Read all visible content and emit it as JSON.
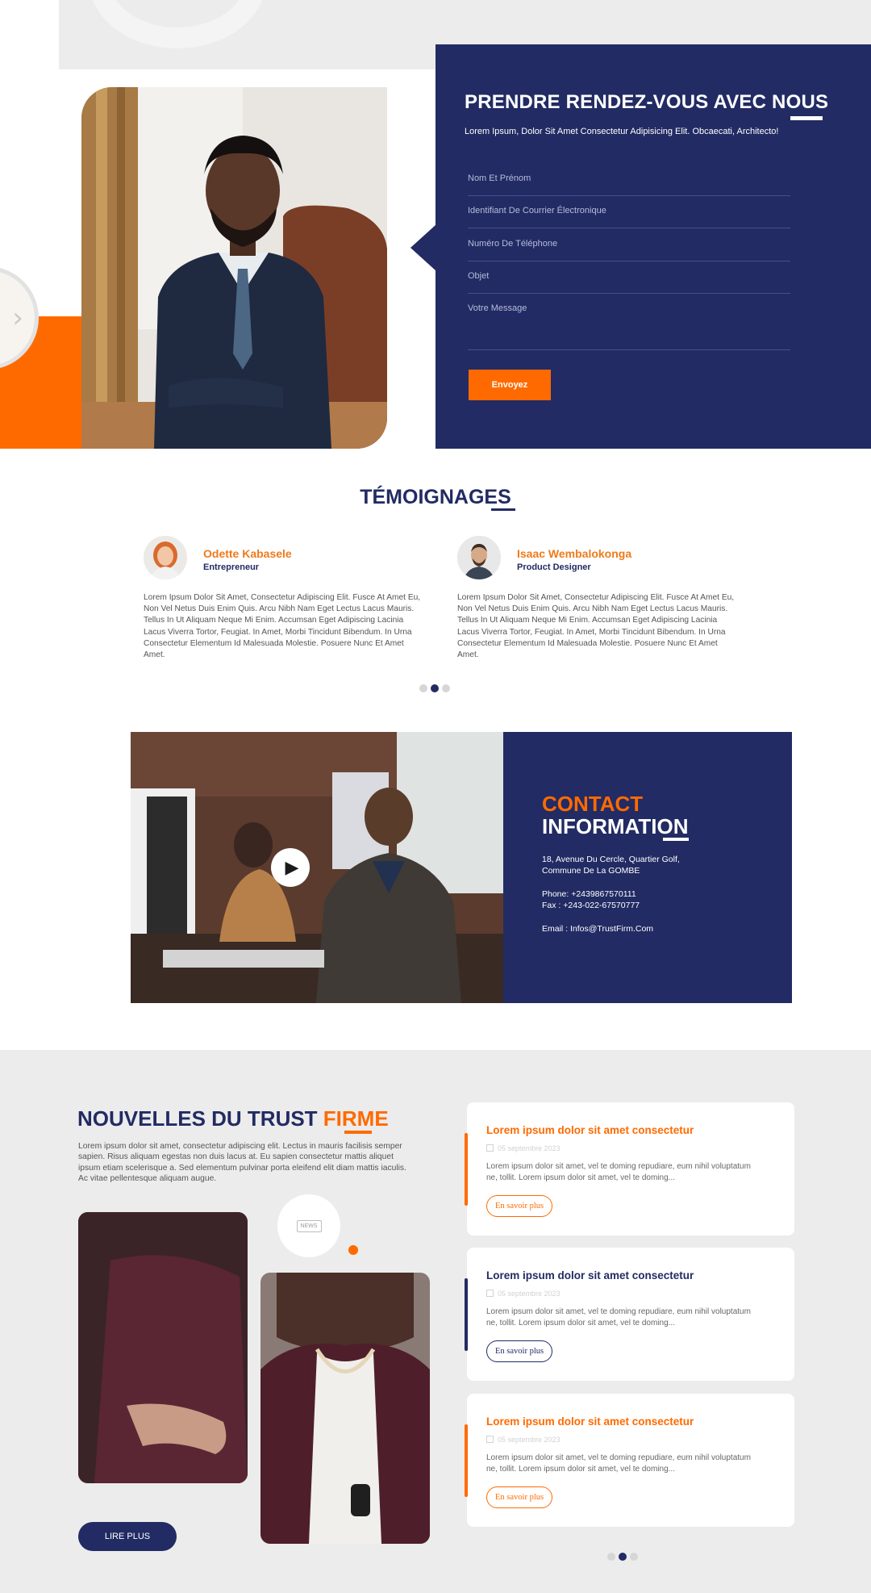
{
  "appointment": {
    "title": "PRENDRE RENDEZ-VOUS AVEC NOUS",
    "subtitle": "Lorem Ipsum, Dolor Sit Amet Consectetur Adipisicing Elit. Obcaecati, Architecto!",
    "fields": {
      "name": "Nom Et Prénom",
      "email": "Identifiant De Courrier Électronique",
      "phone": "Numéro De Téléphone",
      "subject": "Objet",
      "message": "Votre Message"
    },
    "submit_label": "Envoyez"
  },
  "testimonials": {
    "title": "TÉMOIGNAGES",
    "items": [
      {
        "name": "Odette Kabasele",
        "role": "Entrepreneur",
        "text": "Lorem Ipsum Dolor Sit Amet, Consectetur Adipiscing Elit. Fusce At Amet Eu, Non Vel Netus Duis Enim Quis. Arcu Nibh Nam Eget Lectus Lacus Mauris. Tellus In Ut Aliquam Neque Mi Enim. Accumsan Eget Adipiscing Lacinia Lacus Viverra Tortor, Feugiat. In Amet, Morbi Tincidunt Bibendum. In Urna Consectetur Elementum Id Malesuada Molestie. Posuere Nunc Et Amet Amet."
      },
      {
        "name": "Isaac Wembalokonga",
        "role": "Product Designer",
        "text": "Lorem Ipsum Dolor Sit Amet, Consectetur Adipiscing Elit. Fusce At Amet Eu, Non Vel Netus Duis Enim Quis. Arcu Nibh Nam Eget Lectus Lacus Mauris. Tellus In Ut Aliquam Neque Mi Enim. Accumsan Eget Adipiscing Lacinia Lacus Viverra Tortor, Feugiat. In Amet, Morbi Tincidunt Bibendum. In Urna Consectetur Elementum Id Malesuada Molestie. Posuere Nunc Et Amet Amet."
      }
    ],
    "active_dot": 2,
    "dot_count": 3
  },
  "contact": {
    "title_line1": "CONTACT",
    "title_line2": "INFORMATION",
    "address_line1": "18, Avenue Du Cercle, Quartier Golf,",
    "address_line2": "Commune De La  GOMBE",
    "phone": "Phone: +2439867570111",
    "fax": "Fax : +243-022-67570777",
    "email": "Email : Infos@TrustFirm.Com"
  },
  "news": {
    "title_main": "NOUVELLES DU TRUST ",
    "title_accent": "FIRME",
    "intro": "Lorem ipsum dolor sit amet, consectetur adipiscing elit. Lectus in mauris facilisis semper sapien. Risus aliquam egestas non duis lacus at. Eu sapien consectetur mattis aliquet ipsum etiam scelerisque a. Sed elementum pulvinar porta eleifend elit diam mattis iaculis. Ac vitae pellentesque aliquam augue.",
    "bubble_label": "NEWS",
    "more_label": "LIRE PLUS",
    "cards": [
      {
        "title": "Lorem ipsum dolor sit amet consectetur",
        "date": "05 septembre 2023",
        "body": "Lorem ipsum dolor sit amet, vel te doming repudiare, eum nihil voluptatum ne, tollit. Lorem ipsum dolor sit amet, vel te doming...",
        "button": "En savoir plus",
        "accent": "#ff6a00"
      },
      {
        "title": "Lorem ipsum dolor sit amet consectetur",
        "date": "05 septembre 2023",
        "body": "Lorem ipsum dolor sit amet, vel te doming repudiare, eum nihil voluptatum ne, tollit. Lorem ipsum dolor sit amet, vel te doming...",
        "button": "En savoir plus",
        "accent": "#222b63"
      },
      {
        "title": "Lorem ipsum dolor sit amet consectetur",
        "date": "05 septembre 2023",
        "body": "Lorem ipsum dolor sit amet, vel te doming repudiare, eum nihil voluptatum ne, tollit. Lorem ipsum dolor sit amet, vel te doming...",
        "button": "En savoir plus",
        "accent": "#ff6a00"
      }
    ],
    "active_dot": 2,
    "dot_count": 3
  },
  "colors": {
    "navy": "#222b63",
    "orange": "#ff6a00",
    "light_gray": "#ececec"
  },
  "icons": {
    "slider_prev": "chevron-left-icon",
    "video": "play-icon",
    "date": "calendar-icon"
  }
}
